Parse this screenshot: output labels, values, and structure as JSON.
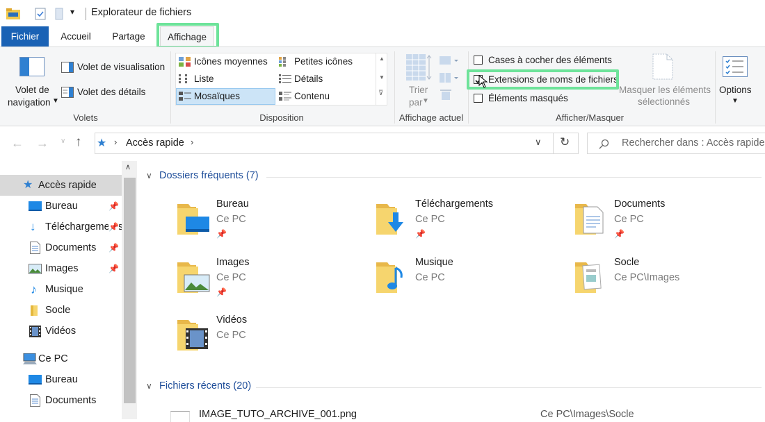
{
  "window": {
    "title": "Explorateur de fichiers"
  },
  "tabs": {
    "file": "Fichier",
    "home": "Accueil",
    "share": "Partage",
    "view": "Affichage"
  },
  "ribbon": {
    "panes": {
      "nav_pane_line1": "Volet de",
      "nav_pane_line2": "navigation",
      "preview": "Volet de visualisation",
      "details": "Volet des détails",
      "label": "Volets"
    },
    "layout": {
      "items": [
        "Icônes moyennes",
        "Petites icônes",
        "Liste",
        "Détails",
        "Mosaïques",
        "Contenu"
      ],
      "selected": "Mosaïques",
      "label": "Disposition"
    },
    "current_view": {
      "sort_line1": "Trier",
      "sort_line2": "par",
      "label": "Affichage actuel"
    },
    "show_hide": {
      "item_checkboxes": "Cases à cocher des éléments",
      "file_extensions": "Extensions de noms de fichiers",
      "hidden_items": "Éléments masqués",
      "hide_selected_line1": "Masquer les éléments",
      "hide_selected_line2": "sélectionnés",
      "label": "Afficher/Masquer"
    },
    "options": {
      "label": "Options"
    }
  },
  "address": {
    "location": "Accès rapide",
    "search_placeholder": "Rechercher dans : Accès rapide"
  },
  "sidebar": {
    "quick_access": "Accès rapide",
    "items": [
      {
        "label": "Bureau",
        "pinned": true
      },
      {
        "label": "Téléchargements",
        "pinned": true
      },
      {
        "label": "Documents",
        "pinned": true
      },
      {
        "label": "Images",
        "pinned": true
      },
      {
        "label": "Musique",
        "pinned": false
      },
      {
        "label": "Socle",
        "pinned": false
      },
      {
        "label": "Vidéos",
        "pinned": false
      }
    ],
    "this_pc": "Ce PC",
    "pc_items": [
      "Bureau",
      "Documents"
    ]
  },
  "main": {
    "frequent_header": "Dossiers fréquents (7)",
    "recent_header": "Fichiers récents (20)",
    "folders": [
      {
        "name": "Bureau",
        "location": "Ce PC",
        "pinned": true
      },
      {
        "name": "Téléchargements",
        "location": "Ce PC",
        "pinned": true
      },
      {
        "name": "Documents",
        "location": "Ce PC",
        "pinned": true
      },
      {
        "name": "Images",
        "location": "Ce PC",
        "pinned": true
      },
      {
        "name": "Musique",
        "location": "Ce PC",
        "pinned": false
      },
      {
        "name": "Socle",
        "location": "Ce PC\\Images",
        "pinned": false
      },
      {
        "name": "Vidéos",
        "location": "Ce PC",
        "pinned": false
      }
    ],
    "recent_files": [
      {
        "name": "IMAGE_TUTO_ARCHIVE_001.png",
        "location": "Ce PC\\Images\\Socle"
      }
    ]
  },
  "colors": {
    "accent": "#1a62b5",
    "highlight": "#6ee39a",
    "section_header": "#1f4e9a",
    "folder": "#f6d56e"
  }
}
